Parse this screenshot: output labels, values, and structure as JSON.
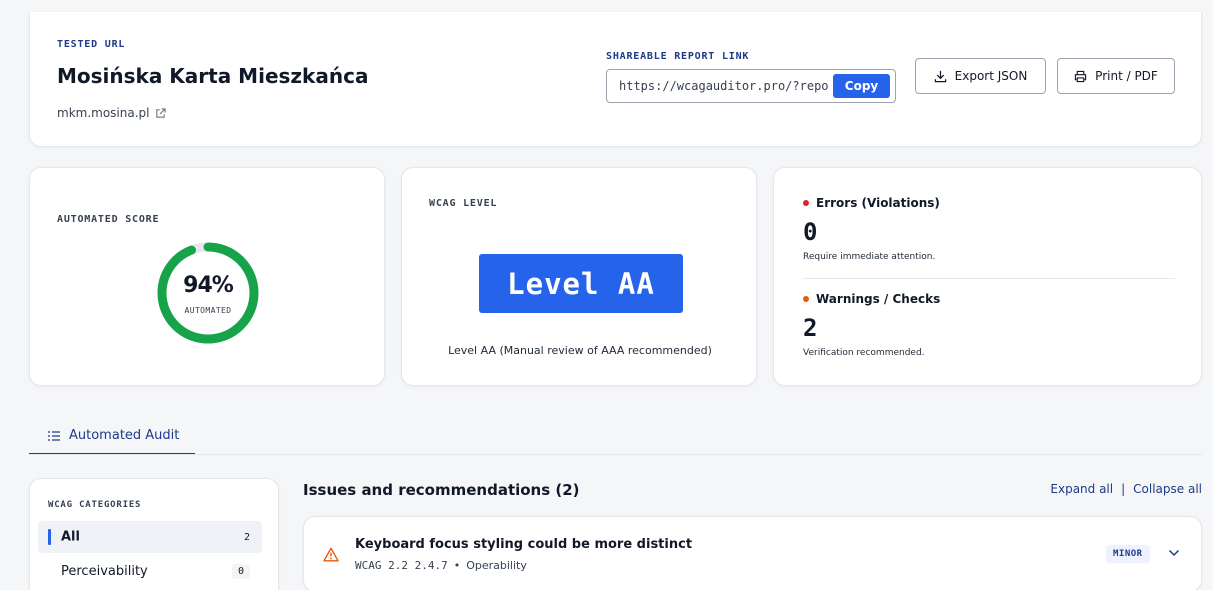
{
  "header": {
    "tested_url_label": "TESTED URL",
    "site_name": "Mosińska Karta Mieszkańca",
    "site_domain": "mkm.mosina.pl",
    "share_label": "SHAREABLE REPORT LINK",
    "share_url": "https://wcagauditor.pro/?repo",
    "copy_label": "Copy",
    "export_label": "Export JSON",
    "print_label": "Print / PDF"
  },
  "score": {
    "label": "AUTOMATED SCORE",
    "value_text": "94%",
    "value": 94,
    "sub": "AUTOMATED",
    "color": "#16a34a"
  },
  "level": {
    "label": "WCAG LEVEL",
    "badge": "Level AA",
    "note": "Level AA (Manual review of AAA recommended)"
  },
  "summary": {
    "errors_label": "Errors (Violations)",
    "errors_count": "0",
    "errors_desc": "Require immediate attention.",
    "errors_color": "#dc2626",
    "warnings_label": "Warnings / Checks",
    "warnings_count": "2",
    "warnings_desc": "Verification recommended.",
    "warnings_color": "#ea580c"
  },
  "tabs": [
    {
      "label": "Automated Audit",
      "icon": "list-check-icon"
    }
  ],
  "categories": {
    "title": "WCAG CATEGORIES",
    "items": [
      {
        "label": "All",
        "count": "2"
      },
      {
        "label": "Perceivability",
        "count": "0"
      }
    ]
  },
  "issues": {
    "title": "Issues and recommendations (2)",
    "expand_all": "Expand all",
    "separator": "|",
    "collapse_all": "Collapse all",
    "list": [
      {
        "title": "Keyboard focus styling could be more distinct",
        "code": "WCAG 2.2 2.4.7",
        "bullet": "•",
        "category": "Operability",
        "severity": "MINOR",
        "icon": "warning-triangle-icon"
      }
    ]
  }
}
